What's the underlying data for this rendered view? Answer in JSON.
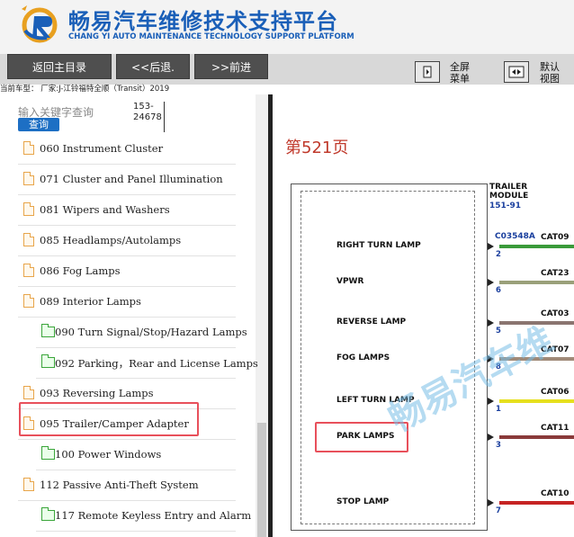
{
  "header": {
    "title_cn": "畅易汽车维修技术支持平台",
    "title_en": "CHANG YI AUTO MAINTENANCE TECHNOLOGY SUPPORT PLATFORM"
  },
  "toolbar": {
    "home_label": "返回主目录",
    "back_label": "<<后退.",
    "forward_label": ">>前进",
    "fullscreen_label_1": "全屏",
    "fullscreen_label_2": "菜单",
    "default_view_label_1": "默认",
    "default_view_label_2": "视图"
  },
  "status_line": "当前车型： 厂家:J-江铃福特全顺（Transit）2019",
  "search": {
    "placeholder": "输入关键字查询",
    "button_label": "查询",
    "result_line_1": "153-",
    "result_line_2": "24678"
  },
  "sidebar": {
    "items": [
      {
        "label": "060 Instrument Cluster",
        "type": "doc"
      },
      {
        "label": "071 Cluster and Panel Illumination",
        "type": "doc"
      },
      {
        "label": "081 Wipers and Washers",
        "type": "doc"
      },
      {
        "label": "085 Headlamps/Autolamps",
        "type": "doc"
      },
      {
        "label": "086 Fog Lamps",
        "type": "doc"
      },
      {
        "label": "089 Interior Lamps",
        "type": "doc"
      },
      {
        "label": "090 Turn Signal/Stop/Hazard Lamps",
        "type": "folder"
      },
      {
        "label": "092 Parking，Rear and License Lamps",
        "type": "folder"
      },
      {
        "label": "093 Reversing Lamps",
        "type": "doc"
      },
      {
        "label": "095 Trailer/Camper Adapter",
        "type": "doc"
      },
      {
        "label": "100 Power Windows",
        "type": "folder"
      },
      {
        "label": "112 Passive Anti-Theft System",
        "type": "doc"
      },
      {
        "label": "117 Remote Keyless Entry and Alarm",
        "type": "folder"
      }
    ]
  },
  "content": {
    "page_number": "第521页",
    "module_title_1": "TRAILER",
    "module_title_2": "MODULE",
    "module_id": "151-91",
    "connector_label": "C03548A",
    "pins": [
      {
        "label": "RIGHT TURN LAMP",
        "pin": "2",
        "circuit": "CAT09",
        "color": "#3a9a3a"
      },
      {
        "label": "VPWR",
        "pin": "6",
        "circuit": "CAT23",
        "color": "#9aa07a"
      },
      {
        "label": "REVERSE LAMP",
        "pin": "5",
        "circuit": "CAT03",
        "color": "#8a7570"
      },
      {
        "label": "FOG LAMPS",
        "pin": "8",
        "circuit": "CAT07",
        "color": "#a08a78"
      },
      {
        "label": "LEFT TURN LAMP",
        "pin": "1",
        "circuit": "CAT06",
        "color": "#e6e01e"
      },
      {
        "label": "PARK LAMPS",
        "pin": "3",
        "circuit": "CAT11",
        "color": "#8a3a3a"
      },
      {
        "label": "STOP LAMP",
        "pin": "7",
        "circuit": "CAT10",
        "color": "#c62424"
      }
    ],
    "watermark": "畅易汽车维"
  }
}
